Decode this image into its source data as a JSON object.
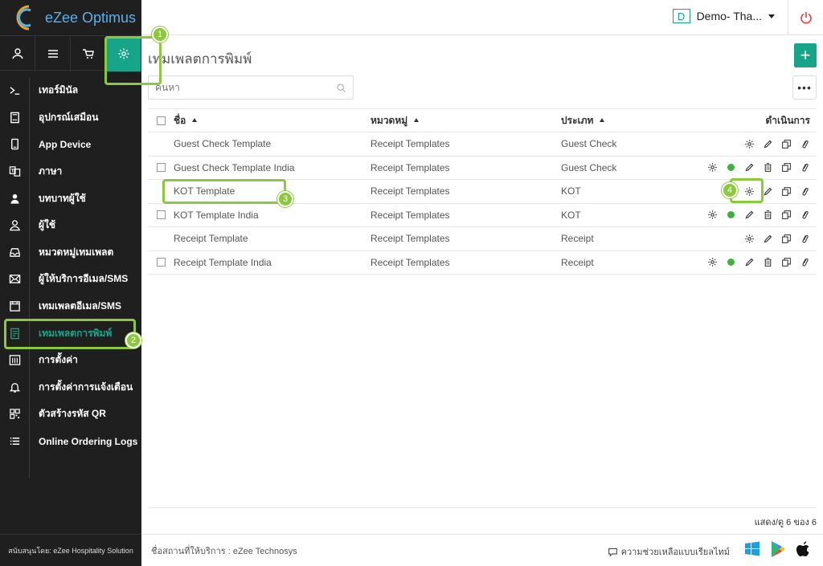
{
  "app": {
    "name": "eZee Optimus"
  },
  "header": {
    "property_initial": "D",
    "property_name": "Demo- Tha..."
  },
  "topnav": [
    {
      "icon": "user-icon"
    },
    {
      "icon": "menu-icon"
    },
    {
      "icon": "cart-icon"
    },
    {
      "icon": "gear-icon",
      "active": true
    }
  ],
  "sidebar": {
    "items": [
      {
        "label": "เทอร์มินัล",
        "icon": "terminal-icon"
      },
      {
        "label": "อุปกรณ์เสมือน",
        "icon": "device-icon"
      },
      {
        "label": "App Device",
        "icon": "mobile-icon"
      },
      {
        "label": "ภาษา",
        "icon": "language-icon"
      },
      {
        "label": "บทบาทผู้ใช้",
        "icon": "role-icon"
      },
      {
        "label": "ผู้ใช้",
        "icon": "user-icon"
      },
      {
        "label": "หมวดหมู่เทมเพลต",
        "icon": "inbox-icon"
      },
      {
        "label": "ผู้ให้บริการอีเมล/SMS",
        "icon": "mail-icon"
      },
      {
        "label": "เทมเพลตอีเมล/SMS",
        "icon": "window-icon"
      },
      {
        "label": "เทมเพลตการพิมพ์",
        "icon": "print-template-icon",
        "active": true
      },
      {
        "label": "การตั้งค่า",
        "icon": "settings-panel-icon"
      },
      {
        "label": "การตั้งค่าการแจ้งเตือน",
        "icon": "bell-icon"
      },
      {
        "label": "ตัวสร้างรหัส QR",
        "icon": "qr-icon"
      },
      {
        "label": "Online Ordering Logs",
        "icon": "list-icon"
      }
    ],
    "footer": "สนับสนุนโดย: eZee Hospitality Solution"
  },
  "main": {
    "title": "เทมเพลตการพิมพ์",
    "add_label": "+",
    "search_placeholder": "ค้นหา",
    "more_label": "•••",
    "columns": {
      "name": "ชื่อ",
      "category": "หมวดหมู่",
      "type": "ประเภท",
      "actions": "ดำเนินการ"
    },
    "rows": [
      {
        "name": "Guest Check Template",
        "category": "Receipt Templates",
        "type": "Guest Check",
        "checkbox": false,
        "status": false,
        "delete": false
      },
      {
        "name": "Guest Check Template India",
        "category": "Receipt Templates",
        "type": "Guest Check",
        "checkbox": true,
        "status": true,
        "delete": true
      },
      {
        "name": "KOT Template",
        "category": "Receipt Templates",
        "type": "KOT",
        "checkbox": false,
        "status": false,
        "delete": false
      },
      {
        "name": "KOT Template India",
        "category": "Receipt Templates",
        "type": "KOT",
        "checkbox": true,
        "status": true,
        "delete": true
      },
      {
        "name": "Receipt Template",
        "category": "Receipt Templates",
        "type": "Receipt",
        "checkbox": false,
        "status": false,
        "delete": false
      },
      {
        "name": "Receipt Template India",
        "category": "Receipt Templates",
        "type": "Receipt",
        "checkbox": true,
        "status": true,
        "delete": true
      }
    ],
    "count_text": "แสดง/ดู 6 ของ 6"
  },
  "footer": {
    "provider": "ชื่อสถานที่ให้บริการ : eZee Technosys",
    "help": "ความช่วยเหลือแบบเรียลไทม์"
  },
  "annotations": [
    "1",
    "2",
    "3",
    "4"
  ],
  "colors": {
    "accent": "#17a589",
    "sidebar_bg": "#1f1f1f",
    "annotation": "#8cc83c",
    "status_green": "#3cb43c"
  }
}
